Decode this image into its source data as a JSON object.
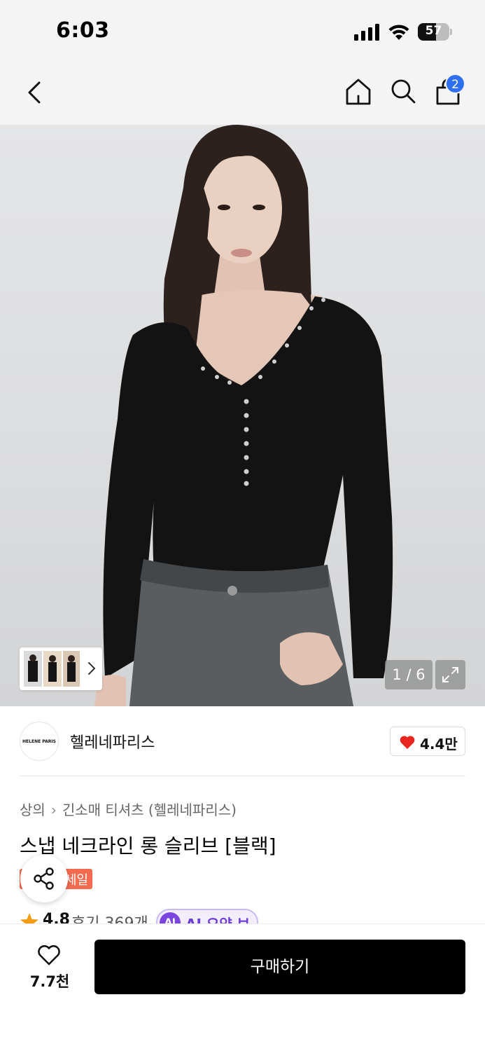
{
  "status_bar": {
    "time": "6:03",
    "battery": "57",
    "battery_level": 0.57
  },
  "nav": {
    "cart_count": "2",
    "icons": [
      "chevron-left-icon",
      "home-icon",
      "search-icon",
      "cart-icon"
    ]
  },
  "hero": {
    "page_counter": "1 / 6"
  },
  "brand": {
    "logo_text": "HELENE PARIS",
    "name": "헬레네파리스",
    "like_count": "4.4만"
  },
  "product": {
    "breadcrumb_category": "상의",
    "breadcrumb_sub": "긴소매 티셔츠 (헬레네파리스)",
    "title": "스냅 네크라인 롱 슬리브 [블랙]",
    "sale_label": "세일",
    "rating": "4.8",
    "reviews": "후기 369개",
    "ai_badge": "AI",
    "ai_summary_label": "AI 요약 보기"
  },
  "bottom": {
    "wish_count": "7.7천",
    "buy_label": "구매하기"
  },
  "colors": {
    "accent_blue": "#2f6ff2",
    "sale_red": "#f26b4f",
    "ai_purple": "#7b45e0",
    "buy_black": "#000000",
    "heart_red": "#e8261f",
    "star_orange": "#f39c12"
  }
}
